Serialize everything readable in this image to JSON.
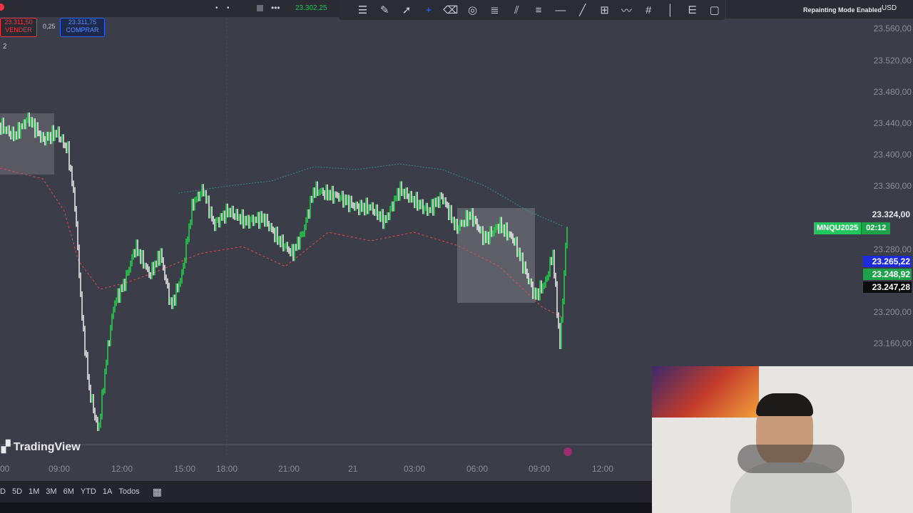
{
  "header": {
    "sell_price": "23.311,50",
    "sell_label": "VENDER",
    "spread": "0,25",
    "buy_price": "23.311,75",
    "buy_label": "COMPRAR",
    "live_price": "23.302,25",
    "side_number": "2"
  },
  "toolbar": {
    "tools": [
      "list-icon",
      "pen-icon",
      "cursor-icon",
      "crosshair-icon",
      "eraser-icon",
      "circle-icon",
      "channel-icon",
      "fib-icon",
      "lines-icon",
      "hline-icon",
      "trendline-icon",
      "grid-icon",
      "path-icon",
      "gann-icon",
      "vline-icon",
      "fan-icon",
      "frame-icon"
    ]
  },
  "status": {
    "repainting": "Repainting Mode Enabled",
    "currency": "USD"
  },
  "chart": {
    "watermark": "TradingView",
    "symbol": "MNQU2025",
    "countdown": "02:12",
    "price_axis": [
      "23.560,00",
      "23.520,00",
      "23.480,00",
      "23.440,00",
      "23.400,00",
      "23.360,00",
      "23.280,00",
      "23.200,00",
      "23.160,00"
    ],
    "last_price": "23.324,00",
    "level_blue": "23.265,22",
    "level_green": "23.248,92",
    "level_black": "23.247,28",
    "time_axis": [
      "00",
      "09:00",
      "12:00",
      "15:00",
      "18:00",
      "21:00",
      "21",
      "03:00",
      "06:00",
      "09:00",
      "12:00"
    ]
  },
  "bottom": {
    "ranges": [
      "D",
      "5D",
      "1M",
      "3M",
      "6M",
      "YTD",
      "1A",
      "Todos"
    ]
  },
  "colors": {
    "sell": "#f23645",
    "buy": "#2962ff",
    "up": "#22e04a",
    "down": "#ffffff"
  }
}
